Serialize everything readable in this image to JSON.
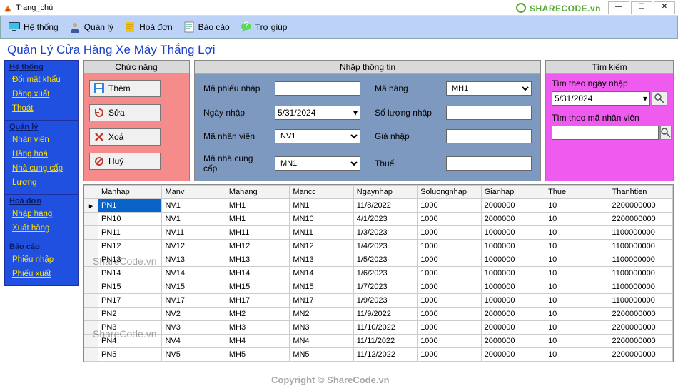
{
  "window": {
    "title": "Trang_chủ"
  },
  "brand": {
    "text": "SHARECODE.vn"
  },
  "menu": {
    "system": "Hệ thống",
    "manage": "Quản lý",
    "invoice": "Hoá đơn",
    "report": "Báo cáo",
    "help": "Trợ giúp"
  },
  "heading": "Quản Lý Cửa Hàng Xe Máy Thắng Lợi",
  "sidebar": {
    "groups": [
      {
        "title": "Hệ thống",
        "links": [
          "Đổi mật khẩu",
          "Đăng xuất",
          "Thoát"
        ]
      },
      {
        "title": "Quản lý",
        "links": [
          "Nhân viên",
          "Hàng hoá",
          "Nhà cung cấp",
          "Lương"
        ]
      },
      {
        "title": "Hoá đơn",
        "links": [
          "Nhập hàng",
          "Xuất hàng"
        ]
      },
      {
        "title": "Báo cáo",
        "links": [
          "Phiếu nhập",
          "Phiếu xuất"
        ]
      }
    ]
  },
  "funcPanel": {
    "title": "Chức năng",
    "add": "Thêm",
    "edit": "Sửa",
    "delete": "Xoá",
    "cancel": "Huỷ"
  },
  "inputPanel": {
    "title": "Nhập thông tin",
    "l_maphieu": "Mã phiếu nhập",
    "l_ngaynhap": "Ngày nhập",
    "l_manv": "Mã nhân viên",
    "l_mancc": "Mã nhà cung cấp",
    "l_mahang": "Mã hàng",
    "l_soluong": "Số lượng nhập",
    "l_gianhap": "Giá nhập",
    "l_thue": "Thuế",
    "v_maphieu": "",
    "v_ngaynhap": "5/31/2024",
    "v_manv": "NV1",
    "v_mancc": "MN1",
    "v_mahang": "MH1",
    "v_soluong": "",
    "v_gianhap": "",
    "v_thue": ""
  },
  "searchPanel": {
    "title": "Tìm kiếm",
    "byDateLabel": "Tìm theo ngày nhập",
    "byDateValue": "5/31/2024",
    "byEmpLabel": "Tìm theo mã nhân viên",
    "byEmpValue": ""
  },
  "grid": {
    "headers": [
      "Manhap",
      "Manv",
      "Mahang",
      "Mancc",
      "Ngaynhap",
      "Soluongnhap",
      "Gianhap",
      "Thue",
      "Thanhtien"
    ],
    "rows": [
      {
        "sel": true,
        "c": [
          "PN1",
          "NV1",
          "MH1",
          "MN1",
          "11/8/2022",
          "1000",
          "2000000",
          "10",
          "2200000000"
        ]
      },
      {
        "sel": false,
        "c": [
          "PN10",
          "NV1",
          "MH1",
          "MN10",
          "4/1/2023",
          "1000",
          "2000000",
          "10",
          "2200000000"
        ]
      },
      {
        "sel": false,
        "c": [
          "PN11",
          "NV11",
          "MH11",
          "MN11",
          "1/3/2023",
          "1000",
          "1000000",
          "10",
          "1100000000"
        ]
      },
      {
        "sel": false,
        "c": [
          "PN12",
          "NV12",
          "MH12",
          "MN12",
          "1/4/2023",
          "1000",
          "1000000",
          "10",
          "1100000000"
        ]
      },
      {
        "sel": false,
        "c": [
          "PN13",
          "NV13",
          "MH13",
          "MN13",
          "1/5/2023",
          "1000",
          "1000000",
          "10",
          "1100000000"
        ]
      },
      {
        "sel": false,
        "c": [
          "PN14",
          "NV14",
          "MH14",
          "MN14",
          "1/6/2023",
          "1000",
          "1000000",
          "10",
          "1100000000"
        ]
      },
      {
        "sel": false,
        "c": [
          "PN15",
          "NV15",
          "MH15",
          "MN15",
          "1/7/2023",
          "1000",
          "1000000",
          "10",
          "1100000000"
        ]
      },
      {
        "sel": false,
        "c": [
          "PN17",
          "NV17",
          "MH17",
          "MN17",
          "1/9/2023",
          "1000",
          "1000000",
          "10",
          "1100000000"
        ]
      },
      {
        "sel": false,
        "c": [
          "PN2",
          "NV2",
          "MH2",
          "MN2",
          "11/9/2022",
          "1000",
          "2000000",
          "10",
          "2200000000"
        ]
      },
      {
        "sel": false,
        "c": [
          "PN3",
          "NV3",
          "MH3",
          "MN3",
          "11/10/2022",
          "1000",
          "2000000",
          "10",
          "2200000000"
        ]
      },
      {
        "sel": false,
        "c": [
          "PN4",
          "NV4",
          "MH4",
          "MN4",
          "11/11/2022",
          "1000",
          "2000000",
          "10",
          "2200000000"
        ]
      },
      {
        "sel": false,
        "c": [
          "PN5",
          "NV5",
          "MH5",
          "MN5",
          "11/12/2022",
          "1000",
          "2000000",
          "10",
          "2200000000"
        ]
      }
    ]
  },
  "watermarks": {
    "w1": "ShareCode.vn",
    "w2": "ShareCode.vn",
    "w3": "Copyright © ShareCode.vn"
  }
}
